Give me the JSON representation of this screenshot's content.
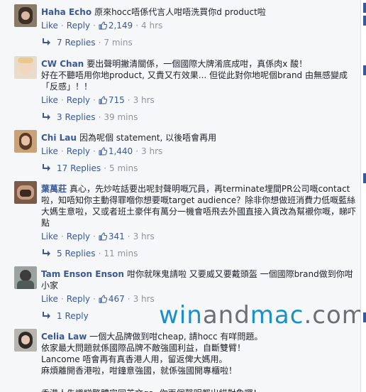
{
  "comments": [
    {
      "author": "Haha Echo",
      "text": "原來hocc唔係代言人咁唔洗買你d product啦",
      "actions": {
        "like": "Like",
        "reply": "Reply",
        "likes": "2,149",
        "time": "4 hrs"
      },
      "replies": {
        "label": "7 Replies",
        "time": "7 mins"
      }
    },
    {
      "author": "CW Chan",
      "text": "要出聲明撇清關係，一個國際大牌淆底成咁，真係肉x 酸！\n好在不聽唔用你地product, 又貴又冇效果... 但從此對你地呢個brand 由無感變成「反感」！！",
      "actions": {
        "like": "Like",
        "reply": "Reply",
        "likes": "715",
        "time": "3 hrs"
      },
      "replies": {
        "label": "3 Replies",
        "time": "39 mins"
      }
    },
    {
      "author": "Chi Lau",
      "text": "因為呢個 statement, 以後唔會再用",
      "actions": {
        "like": "Like",
        "reply": "Reply",
        "likes": "1,440",
        "time": "3 hrs"
      },
      "replies": {
        "label": "17 Replies",
        "time": "5 mins"
      }
    },
    {
      "author": "葉萬莊",
      "text": "真心，先炒咗話要出呢封聲明嘅冗員，再terminate埋間PR公司嘅contact啦，知唔知你主動得罪嗰你想要嘅target audience？除非你想做班消費力低嘅藍絲大媽生意啦，又或者班土豪伴有萬分一機會唔飛去外國直接入貨改為幫襯你嘅，睇吓點",
      "actions": {
        "like": "Like",
        "reply": "Reply",
        "likes": "341",
        "time": "3 hrs"
      },
      "replies": {
        "label": "5 Replies",
        "time": "11 mins"
      }
    },
    {
      "author": "Tam Enson Enson",
      "text": "咁你就咪鬼請啦 又要威又要戴頭盔 一個國際brand做到你咁小家",
      "actions": {
        "like": "Like",
        "reply": "Reply",
        "likes": "467",
        "time": "3 hrs"
      },
      "replies": {
        "label": "1 Reply",
        "time": ""
      }
    },
    {
      "author": "Celia Law",
      "text": "一個大品牌做到咁cheap, 請hocc 有咩問題。\n依家最大問題就係國際品牌不敵強國利益，自斷雙臂！\nLancome 唔會再有真香港人用，留返俾大媽用。\n麻煩離開香港啦，咁鐘意強國，就係強國開專櫃啦！\n\n香港人先識睇繁體字同英文ga, 你兩個聲明都出錯對象囉！"
    }
  ],
  "watermark": {
    "part1": "win",
    "part2": "and",
    "part3": "mac",
    "part4": ".com"
  },
  "colors": {
    "link": "#385898",
    "meta": "#90949c",
    "background": "#f6f7f9"
  }
}
